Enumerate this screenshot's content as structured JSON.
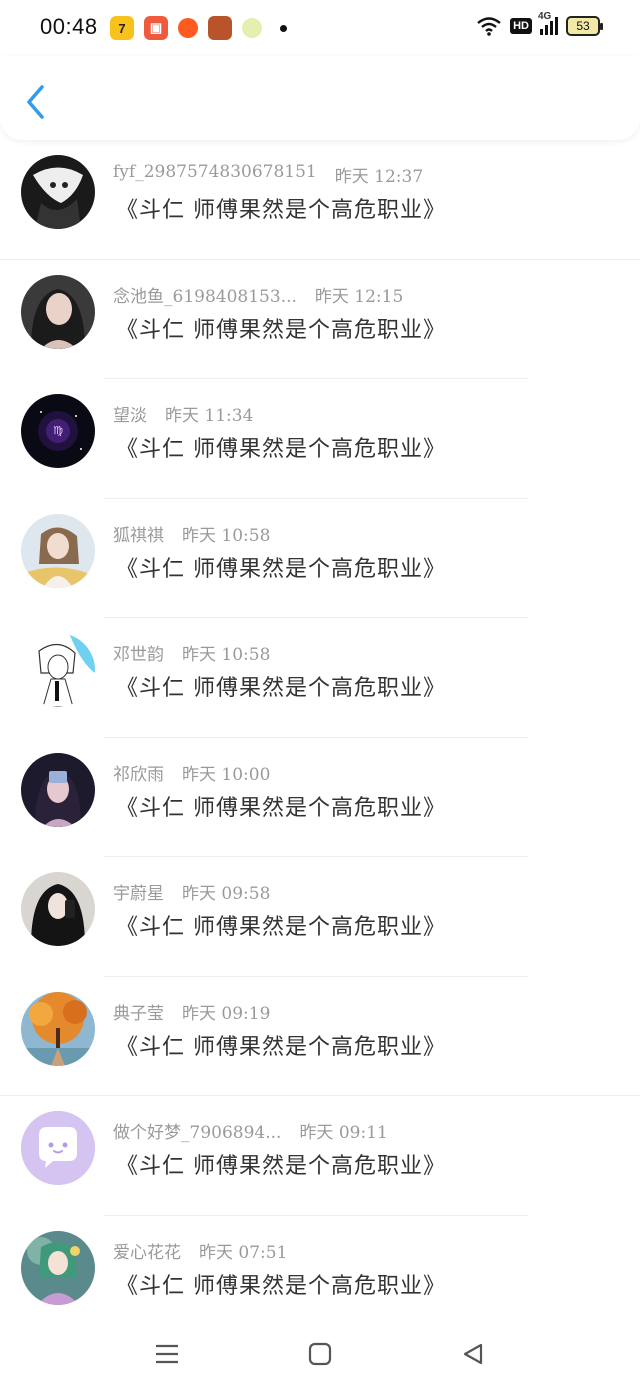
{
  "status_bar": {
    "time": "00:48",
    "hd_label": "HD",
    "network_label": "4G",
    "battery_level": "53",
    "app_icons": [
      "tencent-video-icon",
      "toutiao-icon",
      "taobao-icon",
      "honor-of-kings-icon",
      "wechat-bean-icon"
    ]
  },
  "header": {
    "back_icon": "chevron-left-icon",
    "accent_color": "#2f9bea"
  },
  "list": {
    "items": [
      {
        "name": "fyf_2987574830678151",
        "time": "昨天 12:37",
        "message": "《斗仁 师傅果然是个高危职业》",
        "avatar": "anime-avatar-icon"
      },
      {
        "name": "念池鱼_6198408153...",
        "time": "昨天 12:15",
        "message": "《斗仁 师傅果然是个高危职业》",
        "avatar": "girl-photo-avatar"
      },
      {
        "name": "望淡",
        "time": "昨天 11:34",
        "message": "《斗仁 师傅果然是个高危职业》",
        "avatar": "virgo-avatar"
      },
      {
        "name": "狐祺祺",
        "time": "昨天 10:58",
        "message": "《斗仁 师傅果然是个高危职业》",
        "avatar": "girl-photo-avatar"
      },
      {
        "name": "邓世韵",
        "time": "昨天 10:58",
        "message": "《斗仁 师傅果然是个高危职业》",
        "avatar": "anime-avatar-icon"
      },
      {
        "name": "祁欣雨",
        "time": "昨天 10:00",
        "message": "《斗仁 师傅果然是个高危职业》",
        "avatar": "girl-photo-avatar"
      },
      {
        "name": "宇蔚星",
        "time": "昨天 09:58",
        "message": "《斗仁 师傅果然是个高危职业》",
        "avatar": "selfie-avatar"
      },
      {
        "name": "典子莹",
        "time": "昨天 09:19",
        "message": "《斗仁 师傅果然是个高危职业》",
        "avatar": "autumn-tree-avatar"
      },
      {
        "name": "做个好梦_7906894...",
        "time": "昨天 09:11",
        "message": "《斗仁 师傅果然是个高危职业》",
        "avatar": "default-chat-avatar-icon"
      },
      {
        "name": "爱心花花",
        "time": "昨天 07:51",
        "message": "《斗仁 师傅果然是个高危职业》",
        "avatar": "anime-girl-avatar"
      }
    ]
  },
  "navbar": {
    "menu_icon": "menu-icon",
    "home_icon": "home-square-icon",
    "back_icon": "back-triangle-icon"
  }
}
